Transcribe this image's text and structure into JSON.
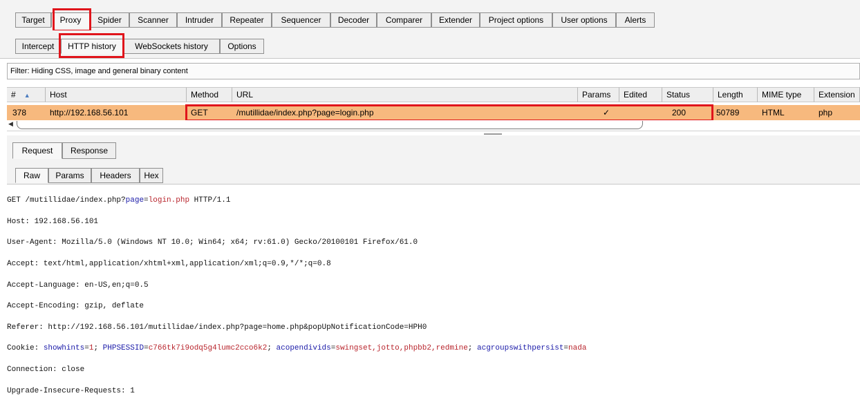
{
  "main_tabs": [
    "Target",
    "Proxy",
    "Spider",
    "Scanner",
    "Intruder",
    "Repeater",
    "Sequencer",
    "Decoder",
    "Comparer",
    "Extender",
    "Project options",
    "User options",
    "Alerts"
  ],
  "proxy_tabs": [
    "Intercept",
    "HTTP history",
    "WebSockets history",
    "Options"
  ],
  "filter_text": "Filter: Hiding CSS, image and general binary content",
  "columns": [
    "#",
    "Host",
    "Method",
    "URL",
    "Params",
    "Edited",
    "Status",
    "Length",
    "MIME type",
    "Extension"
  ],
  "sort_indicator": "▲",
  "row": {
    "num": "378",
    "host": "http://192.168.56.101",
    "method": "GET",
    "url": "/mutillidae/index.php?page=login.php",
    "params": "✓",
    "edited": "",
    "status": "200",
    "length": "50789",
    "mime": "HTML",
    "ext": "php"
  },
  "msg_tabs": [
    "Request",
    "Response"
  ],
  "view_tabs": [
    "Raw",
    "Params",
    "Headers",
    "Hex"
  ],
  "request": {
    "l1_a": "GET /mutillidae/index.php?",
    "l1_k": "page",
    "l1_eq": "=",
    "l1_v": "login.php",
    "l1_b": " HTTP/1.1",
    "l2": "Host: 192.168.56.101",
    "l3": "User-Agent: Mozilla/5.0 (Windows NT 10.0; Win64; x64; rv:61.0) Gecko/20100101 Firefox/61.0",
    "l4": "Accept: text/html,application/xhtml+xml,application/xml;q=0.9,*/*;q=0.8",
    "l5": "Accept-Language: en-US,en;q=0.5",
    "l6": "Accept-Encoding: gzip, deflate",
    "l7": "Referer: http://192.168.56.101/mutillidae/index.php?page=home.php&popUpNotificationCode=HPH0",
    "cookie_prefix": "Cookie: ",
    "c1k": "showhints",
    "c1v": "1",
    "c2k": "PHPSESSID",
    "c2v": "c766tk7i9odq5g4lumc2cco6k2",
    "c3k": "acopendivids",
    "c3v": "swingset,jotto,phpbb2,redmine",
    "c4k": "acgroupswithpersist",
    "c4v": "nada",
    "l9": "Connection: close",
    "l10": "Upgrade-Insecure-Requests: 1"
  }
}
